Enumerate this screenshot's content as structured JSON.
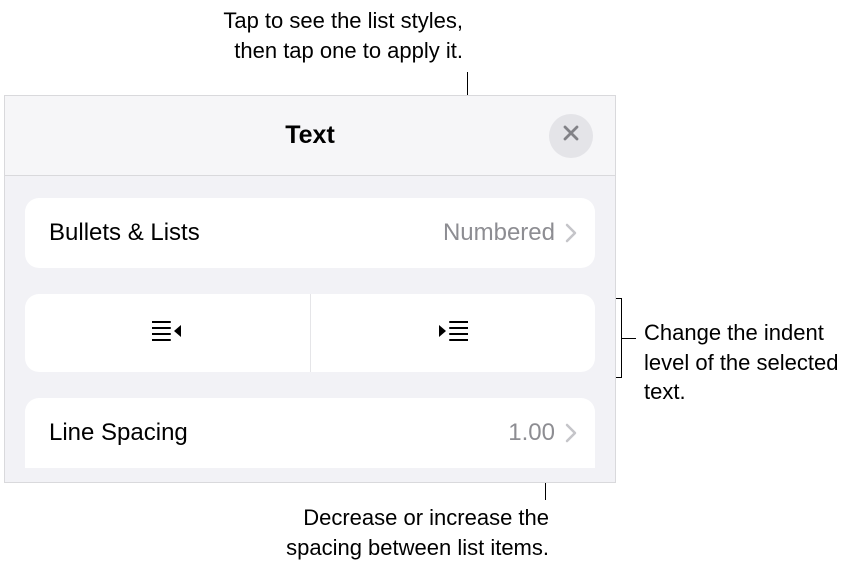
{
  "callouts": {
    "top": "Tap to see the list styles,\nthen tap one to apply it.",
    "right": "Change the indent level of the selected text.",
    "bottom": "Decrease or increase the\nspacing between list items."
  },
  "panel": {
    "title": "Text",
    "bullets_label": "Bullets & Lists",
    "bullets_value": "Numbered",
    "line_spacing_label": "Line Spacing",
    "line_spacing_value": "1.00"
  }
}
